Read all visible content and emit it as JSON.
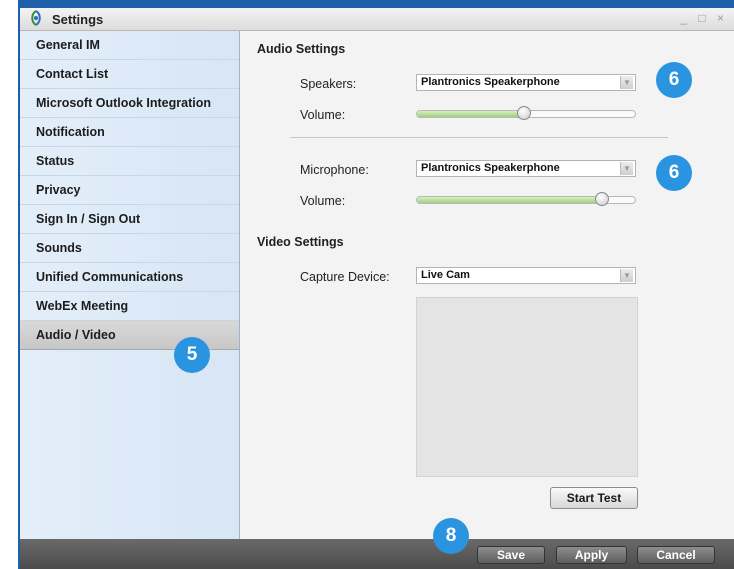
{
  "window": {
    "title": "Settings",
    "controls": "_ □ ×"
  },
  "sidebar": {
    "items": [
      {
        "label": "General IM"
      },
      {
        "label": "Contact List"
      },
      {
        "label": "Microsoft Outlook Integration"
      },
      {
        "label": "Notification"
      },
      {
        "label": "Status"
      },
      {
        "label": "Privacy"
      },
      {
        "label": "Sign In / Sign Out"
      },
      {
        "label": "Sounds"
      },
      {
        "label": "Unified Communications"
      },
      {
        "label": "WebEx Meeting"
      },
      {
        "label": "Audio / Video",
        "selected": true
      }
    ]
  },
  "audio": {
    "title": "Audio Settings",
    "speakers_label": "Speakers:",
    "speakers_value": "Plantronics Speakerphone",
    "speaker_volume_label": "Volume:",
    "speaker_volume": 0.49,
    "microphone_label": "Microphone:",
    "microphone_value": "Plantronics Speakerphone",
    "mic_volume_label": "Volume:",
    "mic_volume": 0.85
  },
  "video": {
    "title": "Video Settings",
    "capture_label": "Capture Device:",
    "capture_value": "Live Cam",
    "start_test": "Start Test"
  },
  "footer": {
    "save": "Save",
    "apply": "Apply",
    "cancel": "Cancel"
  },
  "callouts": {
    "sidebar": "5",
    "speakers": "6",
    "microphone": "6",
    "save": "8"
  },
  "colors": {
    "accent": "#2b94e0",
    "frame": "#1d5fa8",
    "slider_fill": "#9fd07c"
  }
}
